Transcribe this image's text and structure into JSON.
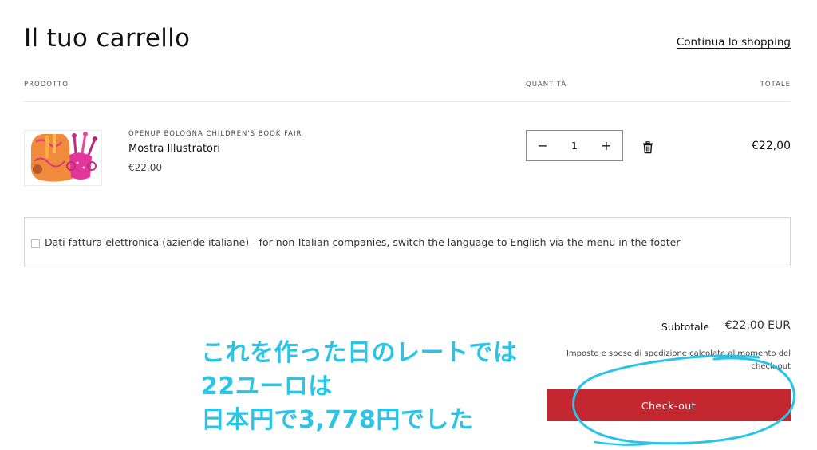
{
  "header": {
    "title": "Il tuo carrello",
    "continue_link": "Continua lo shopping"
  },
  "columns": {
    "product": "PRODOTTO",
    "quantity": "QUANTITÀ",
    "total": "TOTALE"
  },
  "item": {
    "vendor": "OPENUP BOLOGNA CHILDREN'S BOOK FAIR",
    "name": "Mostra Illustratori",
    "price": "€22,00",
    "quantity": "1",
    "line_total": "€22,00",
    "decrease_symbol": "−",
    "increase_symbol": "+"
  },
  "invoice": {
    "label": "Dati fattura elettronica (aziende italiane) - for non-Italian companies, switch the language to English via the menu in the footer",
    "checked": false
  },
  "summary": {
    "subtotal_label": "Subtotale",
    "subtotal_value": "€22,00 EUR",
    "tax_note": "Imposte e spese di spedizione calcolate al momento del check-out",
    "checkout_label": "Check-out"
  },
  "annotation": {
    "line1": "これを作った日のレートでは",
    "line2": "22ユーロは",
    "line3": "日本円で3,778円でした"
  },
  "colors": {
    "accent": "#c3272f",
    "annotation": "#29c4e6"
  }
}
